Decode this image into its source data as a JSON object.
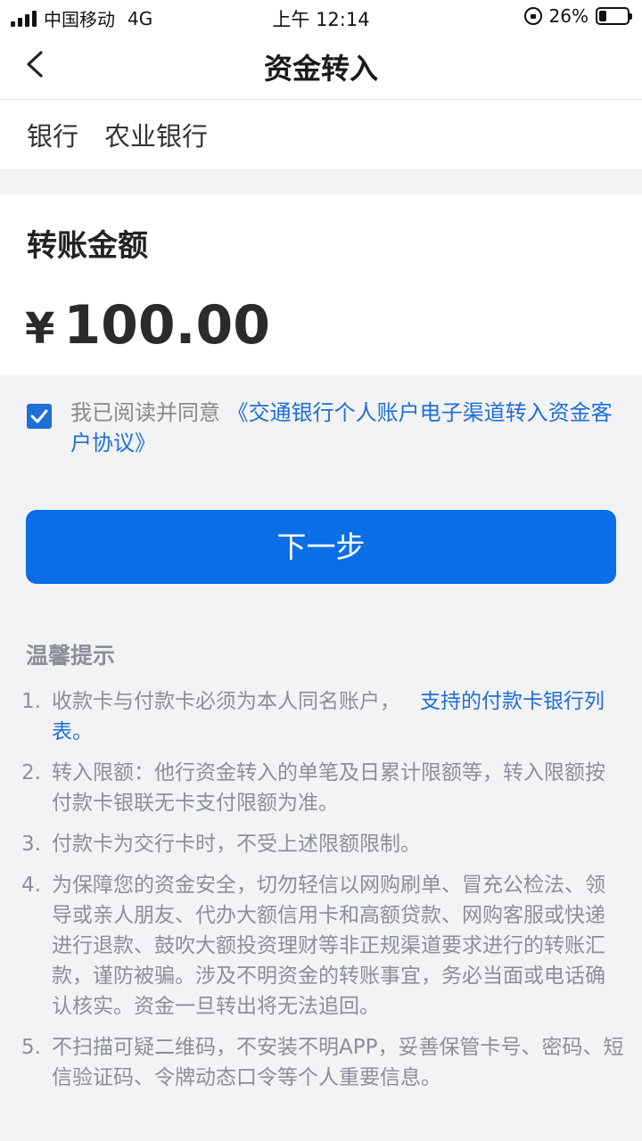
{
  "status_bar": {
    "carrier": "中国移动",
    "network": "4G",
    "time": "上午 12:14",
    "battery": "26%",
    "battery_level": 0.26
  },
  "nav": {
    "back_icon": "chevron-left-icon",
    "title": "资金转入"
  },
  "bank": {
    "label": "银行",
    "value": "农业银行"
  },
  "amount": {
    "title": "转账金额",
    "currency": "¥",
    "value": "100.00"
  },
  "agreement": {
    "checked": true,
    "prefix": "我已阅读并同意",
    "link": "《交通银行个人账户电子渠道转入资金客户协议》"
  },
  "next_button": {
    "label": "下一步"
  },
  "tips": {
    "title": "温馨提示",
    "items": [
      {
        "num": "1.",
        "text": "收款卡与付款卡必须为本人同名账户，",
        "link": "支持的付款卡银行列表。"
      },
      {
        "num": "2.",
        "text": "转入限额：他行资金转入的单笔及日累计限额等，转入限额按付款卡银联无卡支付限额为准。"
      },
      {
        "num": "3.",
        "text": "付款卡为交行卡时，不受上述限额限制。"
      },
      {
        "num": "4.",
        "text": "为保障您的资金安全，切勿轻信以网购刷单、冒充公检法、领导或亲人朋友、代办大额信用卡和高额贷款、网购客服或快递进行退款、鼓吹大额投资理财等非正规渠道要求进行的转账汇款，谨防被骗。涉及不明资金的转账事宜，务必当面或电话确认核实。资金一旦转出将无法追回。"
      },
      {
        "num": "5.",
        "text": "不扫描可疑二维码，不安装不明APP，妥善保管卡号、密码、短信验证码、令牌动态口令等个人重要信息。"
      }
    ]
  },
  "colors": {
    "accent": "#0a6fe6",
    "link": "#1e6fd6",
    "tip_text": "#8a8f99",
    "background": "#f3f3f5"
  }
}
